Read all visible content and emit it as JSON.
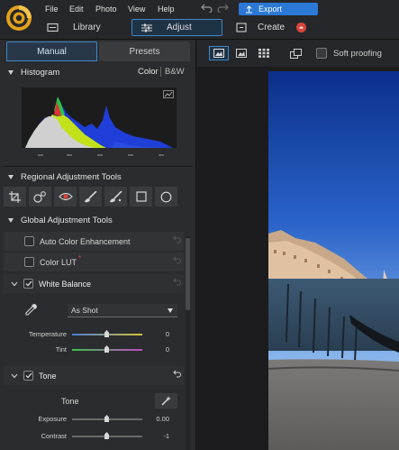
{
  "menu": {
    "file": "File",
    "edit": "Edit",
    "photo": "Photo",
    "view": "View",
    "help": "Help"
  },
  "export_label": "Export",
  "modes": {
    "library": "Library",
    "adjust": "Adjust",
    "create": "Create"
  },
  "view_toolbar": {
    "soft_proofing": "Soft proofing"
  },
  "tabs": {
    "manual": "Manual",
    "presets": "Presets"
  },
  "histogram": {
    "title": "Histogram",
    "color": "Color",
    "bw": "B&W"
  },
  "regional": {
    "title": "Regional Adjustment Tools"
  },
  "global": {
    "title": "Global Adjustment Tools"
  },
  "auto_color": {
    "label": "Auto Color Enhancement",
    "checked": false
  },
  "color_lut": {
    "label": "Color LUT",
    "checked": false,
    "badge": "*"
  },
  "white_balance": {
    "label": "White Balance",
    "checked": true,
    "preset": "As Shot",
    "temperature": {
      "label": "Temperature",
      "value": "0"
    },
    "tint": {
      "label": "Tint",
      "value": "0"
    }
  },
  "tone": {
    "label": "Tone",
    "checked": true,
    "sub_label": "Tone",
    "exposure": {
      "label": "Exposure",
      "value": "0.00"
    },
    "contrast": {
      "label": "Contrast",
      "value": "-1"
    }
  },
  "colors": {
    "accent": "#3c87c8",
    "export_bg": "#2b78d6",
    "panel": "#2b2c2f"
  }
}
